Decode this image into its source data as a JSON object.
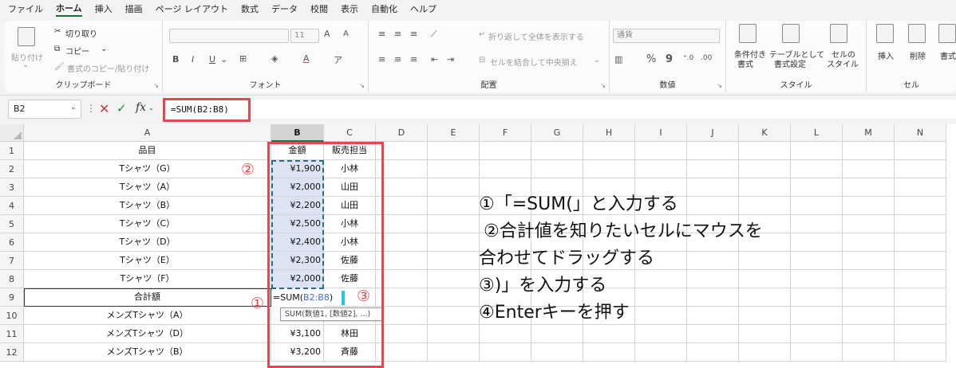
{
  "menu": [
    "ファイル",
    "ホーム",
    "挿入",
    "描画",
    "ページ レイアウト",
    "数式",
    "データ",
    "校閲",
    "表示",
    "自動化",
    "ヘルプ"
  ],
  "active_menu": "ホーム",
  "ribbon": {
    "paste": "貼り付け",
    "cut": "切り取り",
    "copy": "コピー",
    "format_painter": "書式のコピー/貼り付け",
    "clipboard": "クリップボード",
    "font_size": "11",
    "font_grow": "A",
    "font_shrink": "A",
    "bold": "B",
    "italic": "I",
    "underline": "U",
    "font": "フォント",
    "wrap_text": "折り返して全体を表示する",
    "merge_center": "セルを結合して中央揃え",
    "alignment": "配置",
    "number_format": "通貨",
    "percent": "%",
    "comma": "9",
    "number": "数値",
    "cond_format_1": "条件付き",
    "cond_format_2": "書式",
    "format_table_1": "テーブルとして",
    "format_table_2": "書式設定",
    "cell_styles_1": "セルの",
    "cell_styles_2": "スタイル",
    "styles": "スタイル",
    "insert": "挿入",
    "delete": "削除",
    "format": "書式",
    "cells": "セル"
  },
  "formula_bar": {
    "name_box": "B2",
    "formula": "=SUM(B2:B8)"
  },
  "columns": [
    "A",
    "B",
    "C",
    "D",
    "E",
    "F",
    "G",
    "H",
    "I",
    "J",
    "K",
    "L",
    "M",
    "N"
  ],
  "rows": [
    "1",
    "2",
    "3",
    "4",
    "5",
    "6",
    "7",
    "8",
    "9",
    "10",
    "11",
    "12"
  ],
  "cells": {
    "A": [
      "品目",
      "Tシャツ（G）",
      "Tシャツ（A）",
      "Tシャツ（B）",
      "Tシャツ（C）",
      "Tシャツ（D）",
      "Tシャツ（E）",
      "Tシャツ（F）",
      "合計額",
      "メンズTシャツ（A）",
      "メンズTシャツ（D）",
      "メンズTシャツ（B）"
    ],
    "B": [
      "金額",
      "¥1,900",
      "¥2,000",
      "¥2,200",
      "¥2,500",
      "¥2,400",
      "¥2,300",
      "¥2,000",
      "",
      "",
      "¥3,100",
      "¥3,200"
    ],
    "C": [
      "販売担当",
      "小林",
      "山田",
      "山田",
      "小林",
      "小林",
      "佐藤",
      "佐藤",
      "",
      "",
      "林田",
      "斉藤"
    ]
  },
  "editing": {
    "prefix": "=SUM(",
    "ref": "B2:B8",
    "suffix": ")",
    "tooltip": "SUM(数値1, [数値2], ...)"
  },
  "markers": [
    "①",
    "②",
    "③"
  ],
  "instructions": [
    "①「=SUM(」と入力する",
    "②合計値を知りたいセルにマウスを",
    "合わせてドラッグする",
    "③)」を入力する",
    "④Enterキーを押す"
  ]
}
